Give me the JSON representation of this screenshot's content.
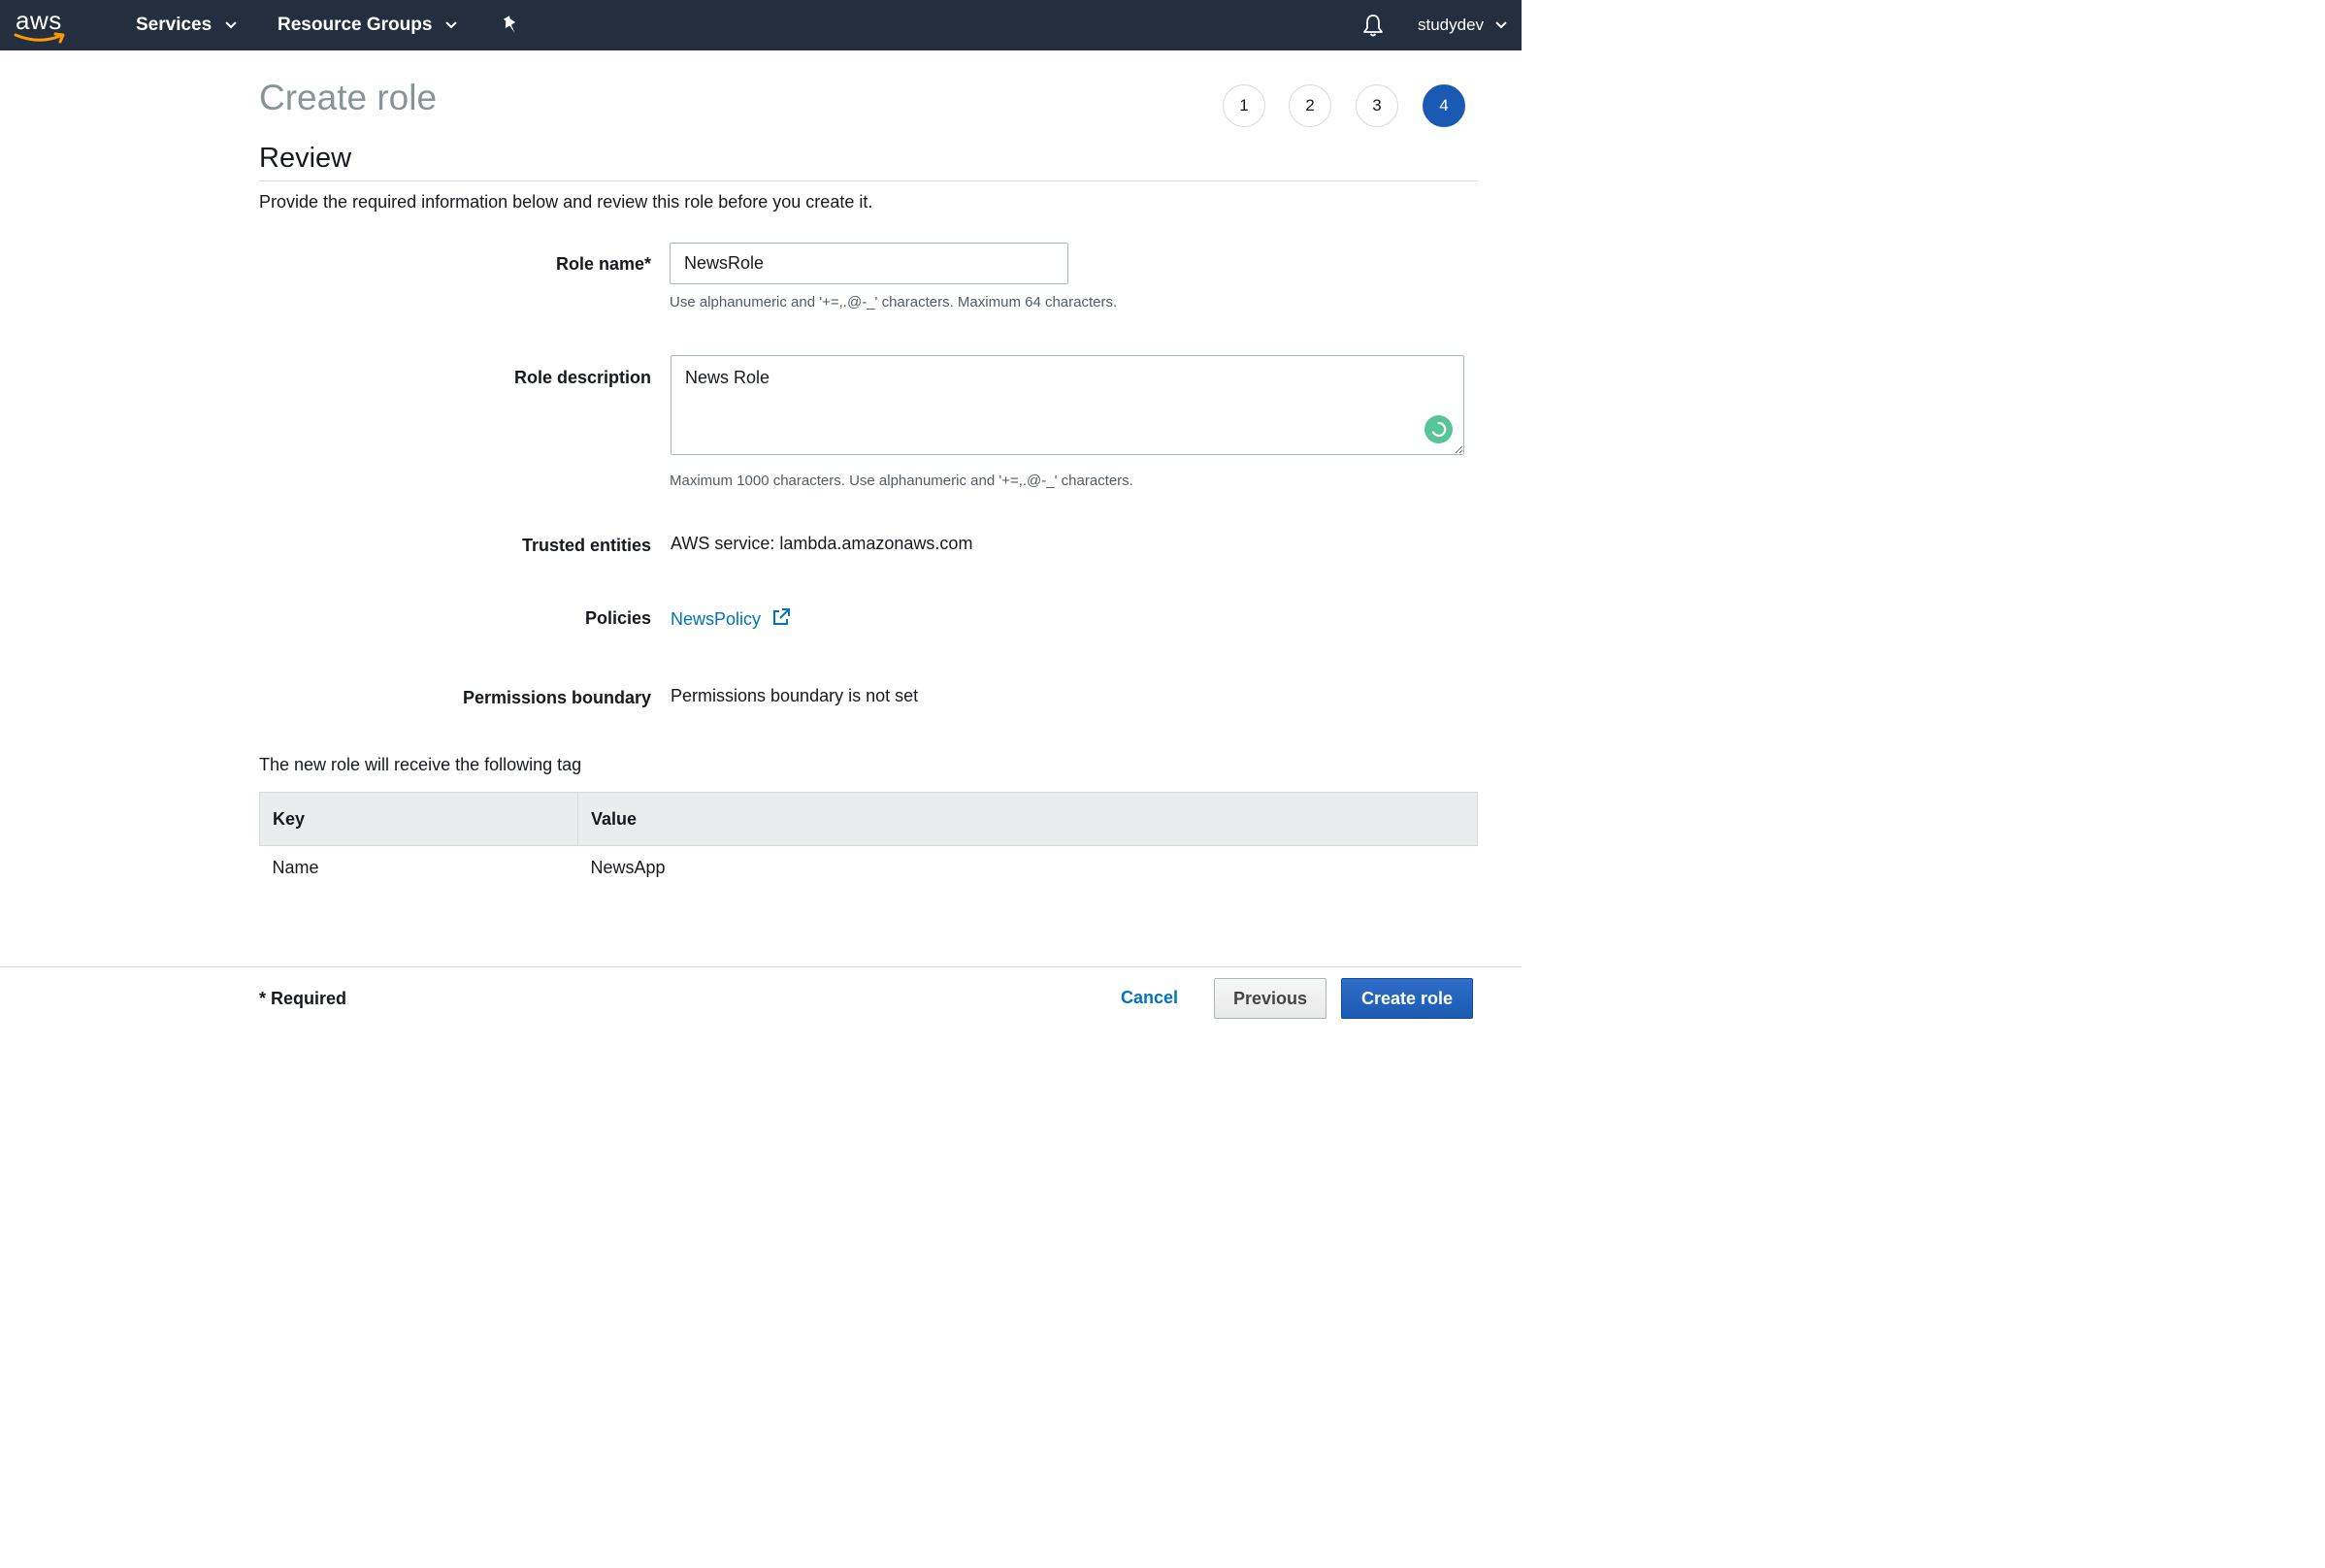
{
  "topnav": {
    "logo_text": "aws",
    "services_label": "Services",
    "resource_groups_label": "Resource Groups",
    "user_label": "studydev"
  },
  "page": {
    "title": "Create role",
    "steps": [
      "1",
      "2",
      "3",
      "4"
    ],
    "active_step": 4,
    "section_title": "Review",
    "intro": "Provide the required information below and review this role before you create it."
  },
  "form": {
    "role_name_label": "Role name*",
    "role_name_value": "NewsRole",
    "role_name_hint": "Use alphanumeric and '+=,.@-_' characters. Maximum 64 characters.",
    "role_description_label": "Role description",
    "role_description_value": "News Role",
    "role_description_hint": "Maximum 1000 characters. Use alphanumeric and '+=,.@-_' characters.",
    "trusted_entities_label": "Trusted entities",
    "trusted_entities_value": "AWS service: lambda.amazonaws.com",
    "policies_label": "Policies",
    "policy_link": "NewsPolicy",
    "permissions_boundary_label": "Permissions boundary",
    "permissions_boundary_value": "Permissions boundary is not set"
  },
  "tags": {
    "intro": "The new role will receive the following tag",
    "headers": [
      "Key",
      "Value"
    ],
    "rows": [
      [
        "Name",
        "NewsApp"
      ]
    ]
  },
  "footer": {
    "required_note": "* Required",
    "cancel_label": "Cancel",
    "previous_label": "Previous",
    "create_label": "Create role"
  },
  "colors": {
    "nav_bg": "#232f3e",
    "accent_orange": "#ff9900",
    "primary_blue": "#1b5ab2",
    "link_blue": "#0073bb"
  }
}
